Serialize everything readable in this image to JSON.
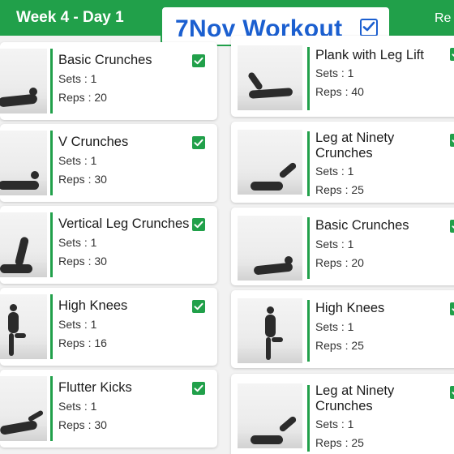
{
  "header": {
    "day_title": "Week 4 - Day 1",
    "right_text": "Re"
  },
  "banner": {
    "title": "7Nov Workout",
    "check_icon": "checkbox-icon"
  },
  "colors": {
    "accent_green": "#21a04a",
    "banner_blue": "#1b5fd0"
  },
  "left_column": [
    {
      "name": "Basic Crunches",
      "sets": "Sets :  1",
      "reps": "Reps : 20",
      "done": true
    },
    {
      "name": "V Crunches",
      "sets": "Sets :  1",
      "reps": "Reps : 30",
      "done": true
    },
    {
      "name": "Vertical Leg Crunches",
      "sets": "Sets :  1",
      "reps": "Reps : 30",
      "done": true
    },
    {
      "name": "High Knees",
      "sets": "Sets :  1",
      "reps": "Reps : 16",
      "done": true
    },
    {
      "name": "Flutter Kicks",
      "sets": "Sets :  1",
      "reps": "Reps : 30",
      "done": true
    }
  ],
  "right_column": [
    {
      "name": "Plank with Leg Lift",
      "sets": "Sets :  1",
      "reps": "Reps : 40",
      "done": true
    },
    {
      "name": "Leg at Ninety Crunches",
      "sets": "Sets :  1",
      "reps": "Reps : 25",
      "done": true
    },
    {
      "name": "Basic Crunches",
      "sets": "Sets :  1",
      "reps": "Reps : 20",
      "done": true
    },
    {
      "name": "High Knees",
      "sets": "Sets :  1",
      "reps": "Reps : 25",
      "done": true
    },
    {
      "name": "Leg at Ninety Crunches",
      "sets": "Sets :  1",
      "reps": "Reps : 25",
      "done": true
    }
  ]
}
